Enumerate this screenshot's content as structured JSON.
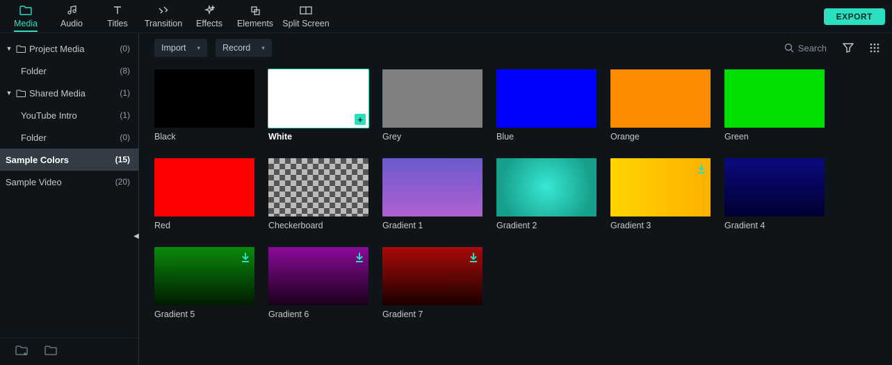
{
  "top_tabs": [
    {
      "id": "media",
      "label": "Media",
      "active": true
    },
    {
      "id": "audio",
      "label": "Audio",
      "active": false
    },
    {
      "id": "titles",
      "label": "Titles",
      "active": false
    },
    {
      "id": "transition",
      "label": "Transition",
      "active": false
    },
    {
      "id": "effects",
      "label": "Effects",
      "active": false
    },
    {
      "id": "elements",
      "label": "Elements",
      "active": false
    },
    {
      "id": "splitscreen",
      "label": "Split Screen",
      "active": false
    }
  ],
  "export_label": "EXPORT",
  "toolbar": {
    "import_label": "Import",
    "record_label": "Record",
    "search_placeholder": "Search"
  },
  "sidebar": [
    {
      "kind": "group",
      "label": "Project Media",
      "count": "(0)"
    },
    {
      "kind": "child",
      "label": "Folder",
      "count": "(8)"
    },
    {
      "kind": "group",
      "label": "Shared Media",
      "count": "(1)"
    },
    {
      "kind": "child",
      "label": "YouTube Intro",
      "count": "(1)"
    },
    {
      "kind": "child",
      "label": "Folder",
      "count": "(0)"
    },
    {
      "kind": "item",
      "label": "Sample Colors",
      "count": "(15)",
      "selected": true
    },
    {
      "kind": "item",
      "label": "Sample Video",
      "count": "(20)"
    }
  ],
  "swatches": [
    {
      "name": "Black",
      "bg": "#000000"
    },
    {
      "name": "White",
      "bg": "#ffffff",
      "selected": true,
      "add": true
    },
    {
      "name": "Grey",
      "bg": "#808080"
    },
    {
      "name": "Blue",
      "bg": "#0000ff"
    },
    {
      "name": "Orange",
      "bg": "#ff8c00"
    },
    {
      "name": "Green",
      "bg": "#00e000"
    },
    {
      "name": "Red",
      "bg": "#ff0000"
    },
    {
      "name": "Checkerboard",
      "checker": true
    },
    {
      "name": "Gradient 1",
      "grad": "linear-gradient(180deg,#6a5acd 0%,#b060d0 100%)"
    },
    {
      "name": "Gradient 2",
      "grad": "radial-gradient(circle at 50% 50%,#38e8d4 0%,#169f8a 80%)"
    },
    {
      "name": "Gradient 3",
      "grad": "linear-gradient(90deg,#ffd400 0%,#ffb000 100%)",
      "dl": true
    },
    {
      "name": "Gradient 4",
      "grad": "linear-gradient(180deg,#0a0a80 0%,#000030 100%)"
    },
    {
      "name": "Gradient 5",
      "grad": "linear-gradient(180deg,#0a8a0a 0%,#001a00 100%)",
      "dl": true
    },
    {
      "name": "Gradient 6",
      "grad": "linear-gradient(180deg,#8a0a9a 0%,#1a001a 100%)",
      "dl": true
    },
    {
      "name": "Gradient 7",
      "grad": "linear-gradient(180deg,#aa0a0a 0%,#1a0000 100%)",
      "dl": true
    }
  ]
}
